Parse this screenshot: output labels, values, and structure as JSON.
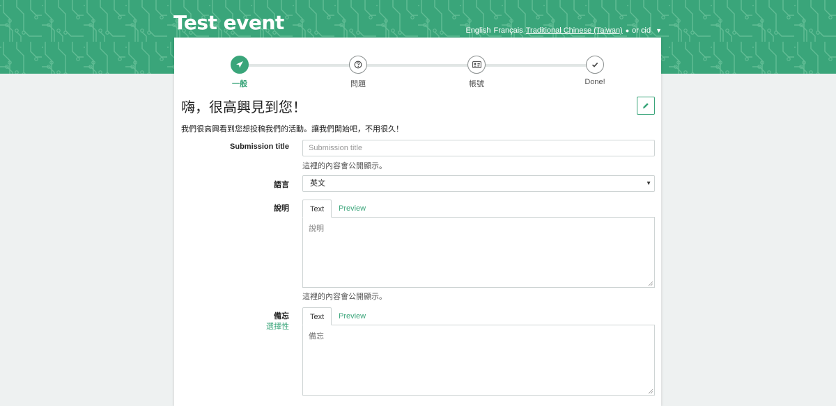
{
  "event": {
    "title": "Test event"
  },
  "languages": {
    "items": [
      {
        "label": "English",
        "active": false
      },
      {
        "label": "Français",
        "active": false
      },
      {
        "label": "Traditional Chinese (Taiwan)",
        "active": true
      }
    ],
    "separator": "or cid"
  },
  "stepper": {
    "steps": [
      {
        "label": "一般",
        "icon": "paper-plane-icon",
        "active": true
      },
      {
        "label": "問題",
        "icon": "question-circle-icon",
        "active": false
      },
      {
        "label": "帳號",
        "icon": "id-card-icon",
        "active": false
      },
      {
        "label": "Done!",
        "icon": "check-icon",
        "active": false
      }
    ]
  },
  "page": {
    "greeting": "嗨，很高興見到您！",
    "intro": "我們很高興看到您想投稿我們的活動。讓我們開始吧，不用很久！"
  },
  "form": {
    "title": {
      "label": "Submission title",
      "placeholder": "Submission title",
      "value": "",
      "help": "這裡的內容會公開顯示。"
    },
    "language": {
      "label": "語言",
      "value": "英文"
    },
    "description": {
      "label": "說明",
      "tab_text": "Text",
      "tab_preview": "Preview",
      "placeholder": "說明",
      "help": "這裡的內容會公開顯示。"
    },
    "notes": {
      "label": "備忘",
      "optional": "選擇性",
      "tab_text": "Text",
      "tab_preview": "Preview",
      "placeholder": "備忘"
    }
  },
  "colors": {
    "brand": "#3aa57a",
    "background": "#eef1f1"
  }
}
